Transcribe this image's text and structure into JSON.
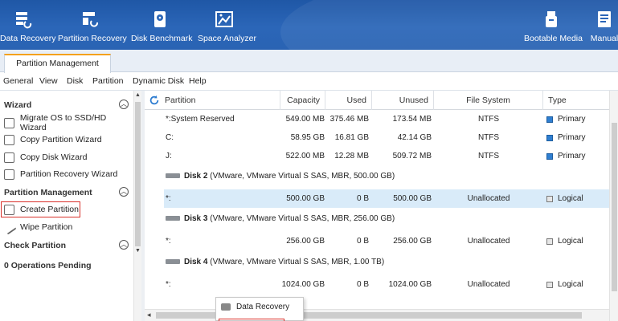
{
  "toolbar": {
    "items": [
      {
        "label": "Data Recovery",
        "icon": "data-recovery-icon"
      },
      {
        "label": "Partition Recovery",
        "icon": "partition-recovery-icon"
      },
      {
        "label": "Disk Benchmark",
        "icon": "disk-benchmark-icon"
      },
      {
        "label": "Space Analyzer",
        "icon": "space-analyzer-icon"
      },
      {
        "label": "Bootable Media",
        "icon": "bootable-media-icon"
      },
      {
        "label": "Manual",
        "icon": "manual-icon"
      }
    ]
  },
  "tabs": {
    "active": "Partition Management"
  },
  "menu": [
    "General",
    "View",
    "Disk",
    "Partition",
    "Dynamic Disk",
    "Help"
  ],
  "left": {
    "wizard_title": "Wizard",
    "wizard_items": [
      "Migrate OS to SSD/HD Wizard",
      "Copy Partition Wizard",
      "Copy Disk Wizard",
      "Partition Recovery Wizard"
    ],
    "pm_title": "Partition Management",
    "pm_items": [
      "Create Partition",
      "Wipe Partition"
    ],
    "check_title": "Check Partition",
    "pending": "0 Operations Pending"
  },
  "table": {
    "headers": [
      "Partition",
      "Capacity",
      "Used",
      "Unused",
      "File System",
      "Type"
    ],
    "rows": [
      {
        "partition": "*:System Reserved",
        "capacity": "549.00 MB",
        "used": "375.46 MB",
        "unused": "173.54 MB",
        "fs": "NTFS",
        "type": "Primary"
      },
      {
        "partition": "C:",
        "capacity": "58.95 GB",
        "used": "16.81 GB",
        "unused": "42.14 GB",
        "fs": "NTFS",
        "type": "Primary"
      },
      {
        "partition": "J:",
        "capacity": "522.00 MB",
        "used": "12.28 MB",
        "unused": "509.72 MB",
        "fs": "NTFS",
        "type": "Primary"
      }
    ],
    "disks": [
      {
        "name": "Disk 2",
        "desc": "(VMware, VMware Virtual S SAS, MBR, 500.00 GB)",
        "row": {
          "partition": "*:",
          "capacity": "500.00 GB",
          "used": "0 B",
          "unused": "500.00 GB",
          "fs": "Unallocated",
          "type": "Logical"
        }
      },
      {
        "name": "Disk 3",
        "desc": "(VMware, VMware Virtual S SAS, MBR, 256.00 GB)",
        "row": {
          "partition": "*:",
          "capacity": "256.00 GB",
          "used": "0 B",
          "unused": "256.00 GB",
          "fs": "Unallocated",
          "type": "Logical"
        }
      },
      {
        "name": "Disk 4",
        "desc": "(VMware, VMware Virtual S SAS, MBR, 1.00 TB)",
        "row": {
          "partition": "*:",
          "capacity": "1024.00 GB",
          "used": "0 B",
          "unused": "1024.00 GB",
          "fs": "Unallocated",
          "type": "Logical"
        }
      }
    ]
  },
  "context_menu": {
    "item": "Data Recovery"
  },
  "colors": {
    "toolbar": "#2b66b8",
    "selected_row": "#d9ebf9",
    "primary_box": "#2f7fd1",
    "highlight": "#d9302a"
  }
}
